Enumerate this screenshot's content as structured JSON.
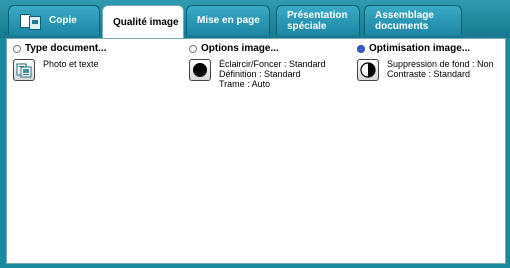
{
  "tabs": [
    {
      "label": "Copie"
    },
    {
      "label": "Qualité image"
    },
    {
      "label": "Mise en page"
    },
    {
      "label": "Présentation spéciale"
    },
    {
      "label": "Assemblage documents"
    }
  ],
  "sections": {
    "type_document": {
      "title": "Type document...",
      "selected": false,
      "value": "Photo et texte",
      "icon": "photo-text-document-icon"
    },
    "options_image": {
      "title": "Options image...",
      "selected": false,
      "lines": [
        "Éclaircir/Foncer : Standard",
        "Définition : Standard",
        "Trame : Auto"
      ],
      "icon": "black-circle-icon"
    },
    "optimisation_image": {
      "title": "Optimisation image...",
      "selected": true,
      "lines": [
        "Suppression de fond : Non",
        "Contraste : Standard"
      ],
      "icon": "half-circle-contrast-icon"
    }
  },
  "colors": {
    "background": "#1a8aa0",
    "selected_radio": "#3a5dc8"
  }
}
